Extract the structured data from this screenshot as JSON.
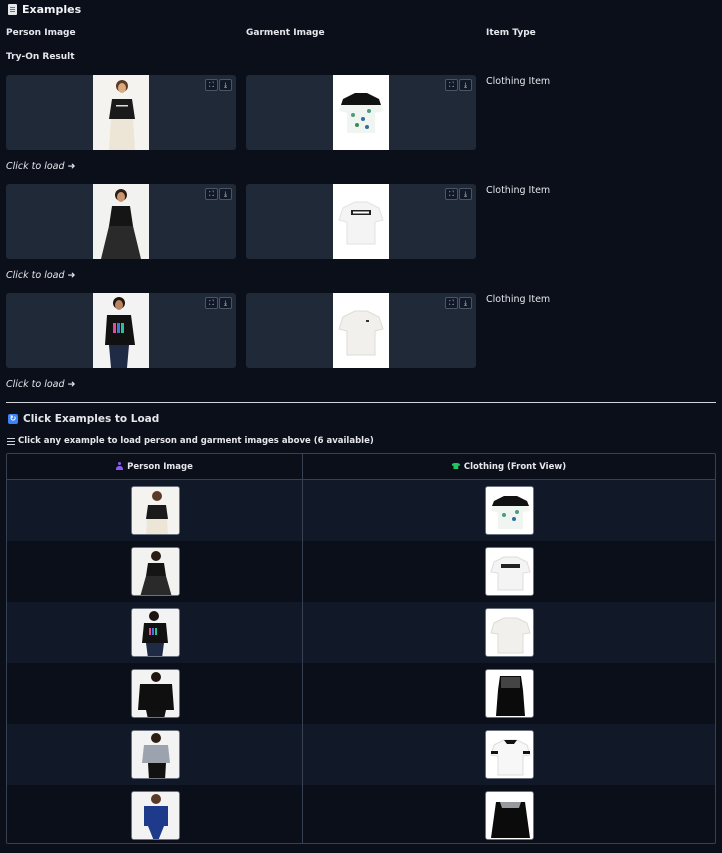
{
  "header": {
    "title": "Examples",
    "columns": {
      "person": "Person Image",
      "garment": "Garment Image",
      "item_type": "Item Type",
      "result": "Try-On Result"
    }
  },
  "rows": [
    {
      "item_type": "Clothing Item",
      "click_label": "Click to load ➜"
    },
    {
      "item_type": "Clothing Item",
      "click_label": "Click to load ➜"
    },
    {
      "item_type": "Clothing Item",
      "click_label": "Click to load ➜"
    }
  ],
  "examples_section": {
    "title": "Click Examples to Load",
    "hint": "Click any example to load person and garment images above (6 available)",
    "col_person": "Person Image",
    "col_clothing": "Clothing (Front View)",
    "row_count": 6
  },
  "icons": {
    "title": "document-icon",
    "section": "refresh-icon",
    "hint": "list-icon",
    "expand": "fullscreen-icon",
    "download": "download-icon",
    "person": "person-icon",
    "clothing": "shirt-icon"
  },
  "colors": {
    "background": "#0b0f19",
    "card": "#1f2937",
    "accent": "#3b82f6"
  }
}
